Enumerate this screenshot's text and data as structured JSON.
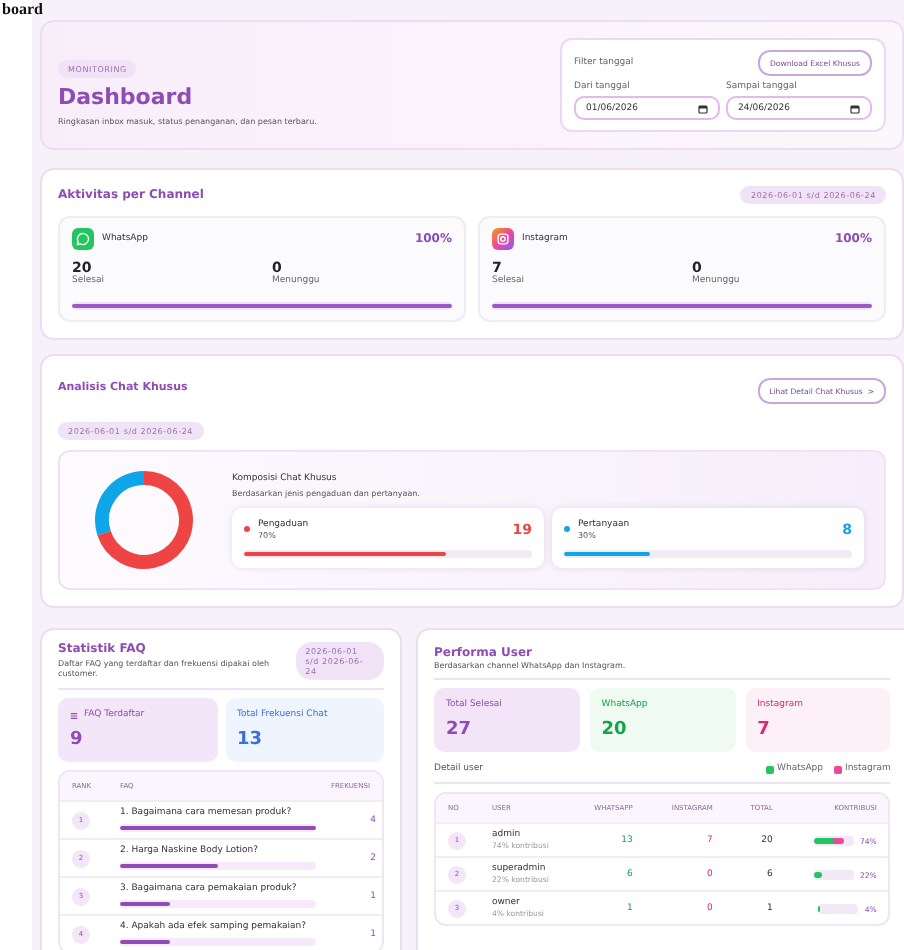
{
  "top_heading": "board",
  "header": {
    "eyebrow": "MONITORING",
    "title": "Dashboard",
    "subtitle": "Ringkasan inbox masuk, status penanganan, dan pesan terbaru.",
    "filter_label": "Filter tanggal",
    "download_button": "Download Excel Khusus",
    "from": {
      "label": "Dari tanggal",
      "value": "01/06/2026"
    },
    "to": {
      "label": "Sampai tanggal",
      "value": "24/06/2026"
    }
  },
  "channel_activity": {
    "title": "Aktivitas per Channel",
    "range": "2026-06-01 s/d 2026-06-24",
    "channels": [
      {
        "kind": "whatsapp",
        "name": "WhatsApp",
        "percent": "100%",
        "done": "20",
        "done_label": "Selesai",
        "waiting": "0",
        "waiting_label": "Menunggu",
        "level": 1
      },
      {
        "kind": "instagram",
        "name": "Instagram",
        "percent": "100%",
        "done": "7",
        "done_label": "Selesai",
        "waiting": "0",
        "waiting_label": "Menunggu",
        "level": 1
      }
    ]
  },
  "special_chat": {
    "title": "Analisis Chat Khusus",
    "detail_button": "Lihat Detail Chat Khusus",
    "button_caret": ">",
    "range": "2026-06-01 s/d 2026-06-24",
    "composition_title": "Komposisi Chat Khusus",
    "composition_subtitle": "Berdasarkan jenis pengaduan dan pertanyaan.",
    "categories": [
      {
        "name": "Pengaduan",
        "percent": "70%",
        "count": "19",
        "color": "#ef4444",
        "level": 0.7
      },
      {
        "name": "Pertanyaan",
        "percent": "30%",
        "count": "8",
        "color": "#0ea5e9",
        "level": 0.3
      }
    ]
  },
  "faq": {
    "title": "Statistik FAQ",
    "subtitle": "Daftar FAQ yang terdaftar dan frekuensi dipakai oleh customer.",
    "range": "2026-06-01 s/d 2026-06-24",
    "registered": {
      "label": "FAQ Terdaftar",
      "value": "9"
    },
    "total": {
      "label": "Total Frekuensi Chat",
      "value": "13"
    },
    "columns": [
      "RANK",
      "FAQ",
      "FREKUENSI"
    ],
    "rows": [
      {
        "rank": "1",
        "question": "1. Bagaimana cara memesan produk?",
        "count": "4",
        "level": 1
      },
      {
        "rank": "2",
        "question": "2. Harga Naskine Body Lotion?",
        "count": "2",
        "level": 0.5
      },
      {
        "rank": "3",
        "question": "3. Bagaimana cara pemakaian produk?",
        "count": "1",
        "level": 0.25
      },
      {
        "rank": "4",
        "question": "4. Apakah ada efek samping pemakaian?",
        "count": "1",
        "level": 0.25
      }
    ]
  },
  "users": {
    "title": "Performa User",
    "subtitle": "Berdasarkan channel WhatsApp dan Instagram.",
    "totals": [
      {
        "kind": "total",
        "label": "Total Selesai",
        "value": "27"
      },
      {
        "kind": "whatsapp",
        "label": "WhatsApp",
        "value": "20"
      },
      {
        "kind": "instagram",
        "label": "Instagram",
        "value": "7"
      }
    ],
    "detail_label": "Detail user",
    "legend": [
      {
        "label": "WhatsApp",
        "color": "#22c55e"
      },
      {
        "label": "Instagram",
        "color": "#ec4899"
      }
    ],
    "columns": [
      "NO",
      "USER",
      "WHATSAPP",
      "INSTAGRAM",
      "TOTAL",
      "KONTRIBUSI"
    ],
    "rows": [
      {
        "no": "1",
        "name": "admin",
        "share": "74% kontribusi",
        "whatsapp": "13",
        "instagram": "7",
        "total": "20",
        "contribution": "74%",
        "level": 0.74
      },
      {
        "no": "2",
        "name": "superadmin",
        "share": "22% kontribusi",
        "whatsapp": "6",
        "instagram": "0",
        "total": "6",
        "contribution": "22%",
        "level": 0.22
      },
      {
        "no": "3",
        "name": "owner",
        "share": "4% kontribusi",
        "whatsapp": "1",
        "instagram": "0",
        "total": "1",
        "contribution": "4%",
        "level": 0.04
      }
    ]
  }
}
